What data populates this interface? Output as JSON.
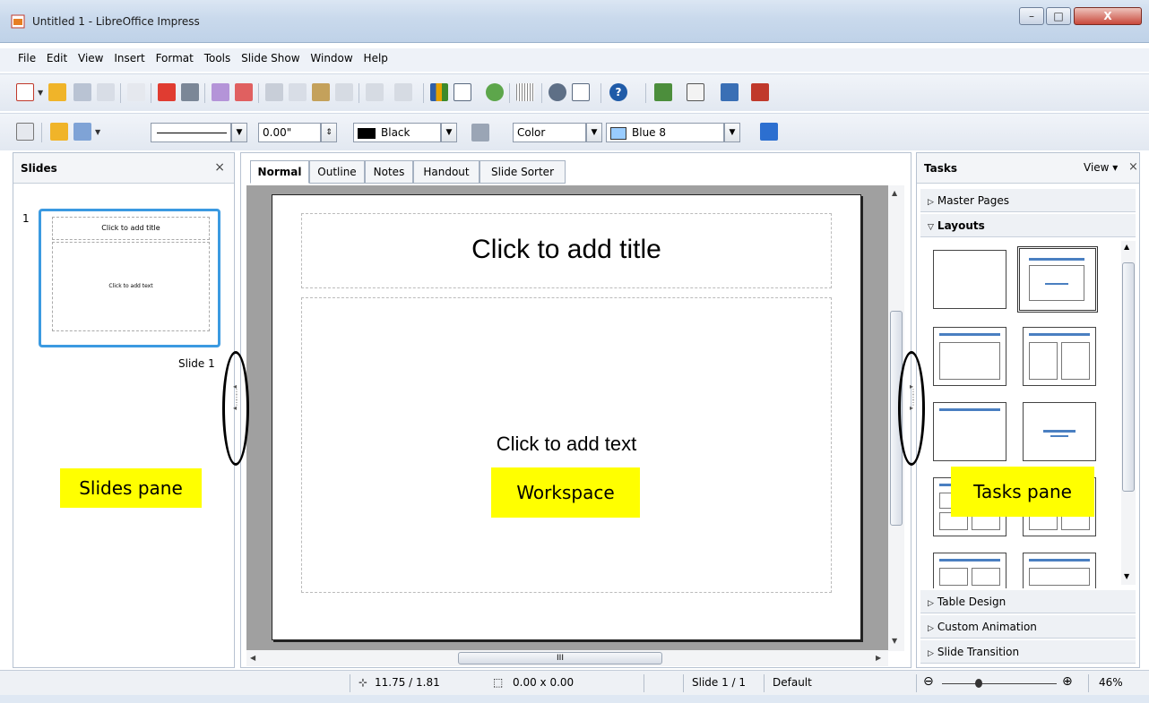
{
  "window": {
    "title": "Untitled 1 - LibreOffice Impress",
    "controls": {
      "minimize": "–",
      "maximize": "□",
      "close": "X"
    }
  },
  "menubar": {
    "items": [
      "File",
      "Edit",
      "View",
      "Insert",
      "Format",
      "Tools",
      "Slide Show",
      "Window",
      "Help"
    ]
  },
  "toolbar_standard": {
    "icons": [
      "new-icon",
      "open-icon",
      "save-icon",
      "email-icon",
      "edit-file-icon",
      "export-pdf-icon",
      "print-icon",
      "spellcheck-icon",
      "autospellcheck-icon",
      "cut-icon",
      "copy-icon",
      "paste-icon",
      "clone-formatting-icon",
      "undo-icon",
      "redo-icon",
      "chart-icon",
      "table-icon",
      "display-views-icon",
      "grid-icon",
      "navigator-icon",
      "zoom-icon",
      "help-icon",
      "slide-icon",
      "slide-layout-icon",
      "master-slide-icon",
      "slide-show-icon"
    ]
  },
  "toolbar_line_fill": {
    "line_width": "0.00\"",
    "line_color": "Black",
    "area_style": "Color",
    "area_fill": "Blue 8",
    "colors": {
      "black": "#000000",
      "blue8": "#99ccff"
    }
  },
  "slides_pane": {
    "title": "Slides",
    "close": "×",
    "slide_number": "1",
    "thumb_title": "Click to add title",
    "thumb_text": "Click to add text",
    "slide_label": "Slide 1"
  },
  "workspace": {
    "tabs": [
      "Normal",
      "Outline",
      "Notes",
      "Handout",
      "Slide Sorter"
    ],
    "active_tab": "Normal",
    "title_placeholder": "Click to add title",
    "text_placeholder": "Click to add text",
    "hscroll_grip": "III"
  },
  "tasks_pane": {
    "title": "Tasks",
    "view_menu": "View ▾",
    "close": "×",
    "sections": {
      "master_pages": "Master Pages",
      "layouts": "Layouts",
      "table_design": "Table Design",
      "custom_animation": "Custom Animation",
      "slide_transition": "Slide Transition"
    }
  },
  "callouts": {
    "slides": "Slides pane",
    "workspace": "Workspace",
    "tasks": "Tasks pane"
  },
  "statusbar": {
    "position": "11.75 / 1.81",
    "size": "0.00 x 0.00",
    "slide": "Slide 1 / 1",
    "master": "Default",
    "zoom": "46%",
    "zoom_out": "⊖",
    "zoom_in": "⊕"
  }
}
